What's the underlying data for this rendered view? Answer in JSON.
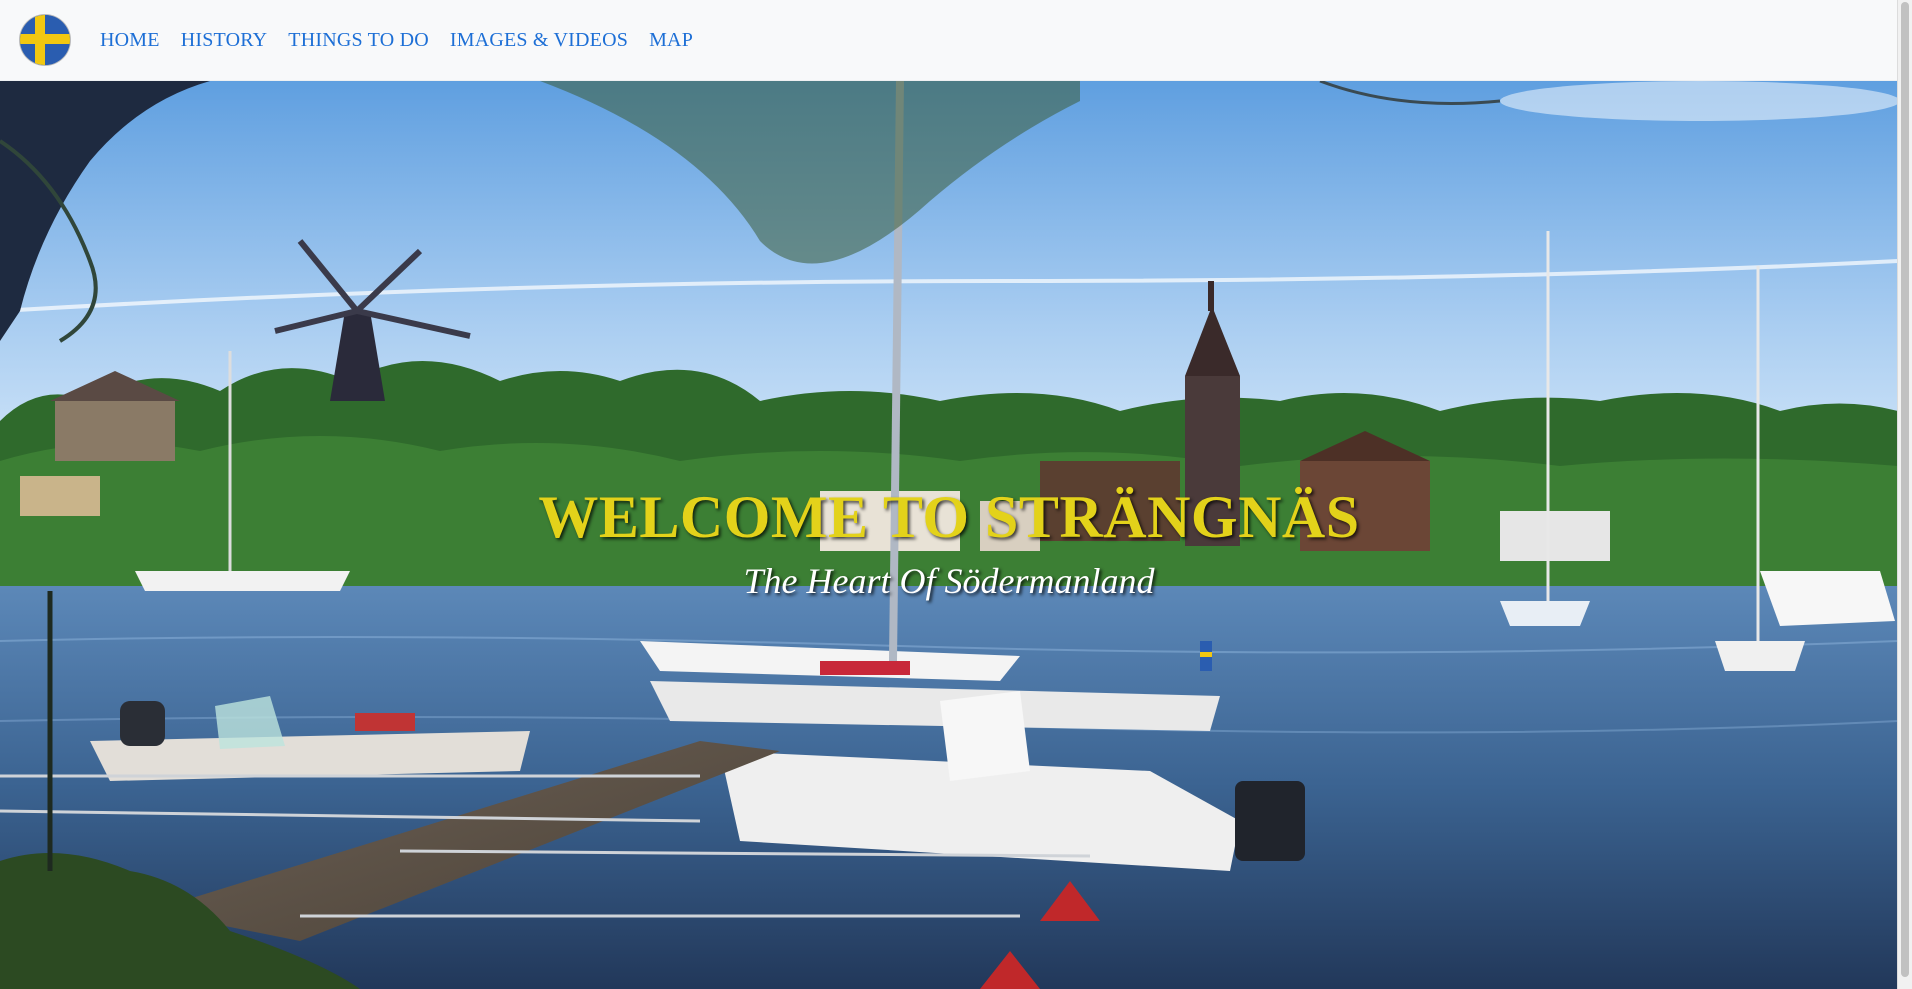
{
  "nav": {
    "logo_icon": "swedish-flag-icon",
    "links": [
      "HOME",
      "HISTORY",
      "THINGS TO DO",
      "IMAGES & VIDEOS",
      "MAP"
    ]
  },
  "hero": {
    "title": "WELCOME TO STRÄNGNÄS",
    "subtitle": "The Heart Of Södermanland"
  },
  "colors": {
    "link": "#1d6fd6",
    "title": "#e3d21a",
    "navbar_bg": "#f8f9fa",
    "flag_blue": "#2a5db0",
    "flag_yellow": "#f2c811"
  }
}
